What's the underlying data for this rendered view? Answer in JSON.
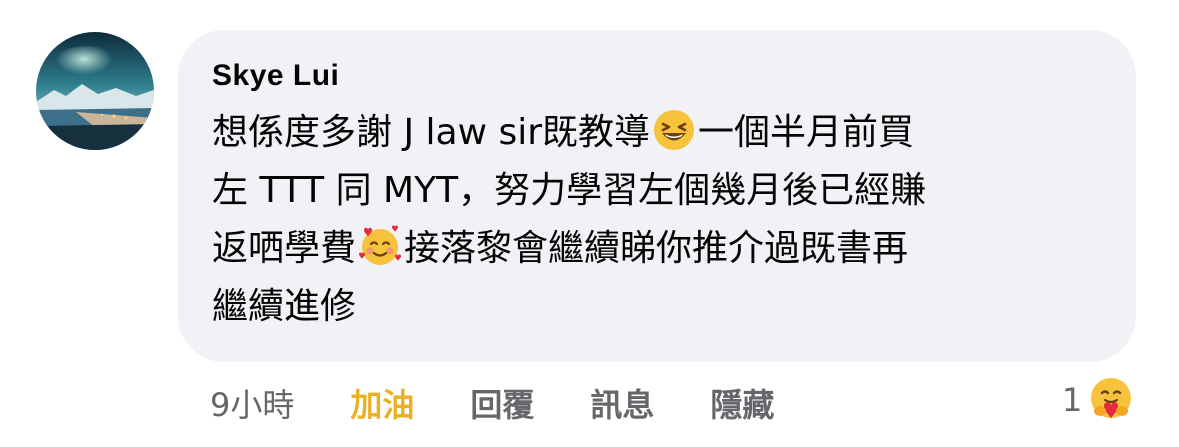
{
  "comment": {
    "author": "Skye Lui",
    "lines": [
      {
        "before": "想係度多謝 J law sir既教導",
        "emoji": "grinning-squinting-face-icon",
        "after": "一個半月前買"
      },
      {
        "text": "左 TTT 同 MYT，努力學習左個幾月後已經賺"
      },
      {
        "before": "返哂學費",
        "emoji": "smiling-face-with-hearts-icon",
        "after": "接落黎會繼續睇你推介過既書再"
      },
      {
        "text": "繼續進修"
      }
    ]
  },
  "footer": {
    "time": "9小時",
    "like_label": "加油",
    "reply_label": "回覆",
    "message_label": "訊息",
    "hide_label": "隱藏"
  },
  "reactions": {
    "count": "1",
    "icon": "care-hug-reaction-icon"
  },
  "colors": {
    "bubble_bg": "#f0f2f5",
    "text": "#050505",
    "secondary_text": "#65676b",
    "reaction_active": "#eab026"
  }
}
